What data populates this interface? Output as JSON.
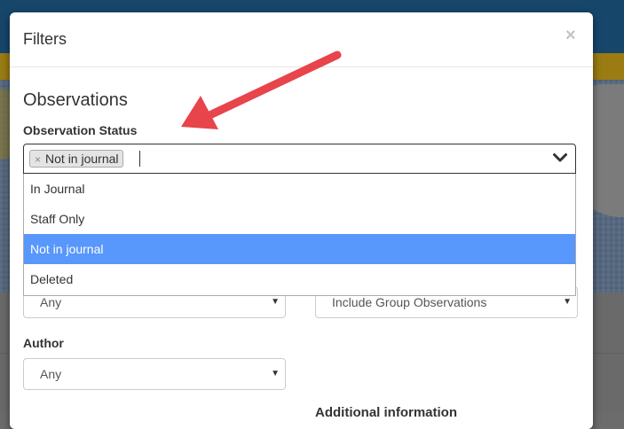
{
  "modal": {
    "title": "Filters",
    "close_symbol": "×",
    "section_title": "Observations"
  },
  "observation_status": {
    "label": "Observation Status",
    "selected_tag": "Not in journal",
    "tag_remove_symbol": "×",
    "options": [
      {
        "label": "In Journal",
        "selected": false
      },
      {
        "label": "Staff Only",
        "selected": false
      },
      {
        "label": "Not in journal",
        "selected": true
      },
      {
        "label": "Deleted",
        "selected": false
      }
    ]
  },
  "selects": {
    "left_value": "Any",
    "right_value": "Include Group Observations",
    "arrow_symbol": "▼"
  },
  "author": {
    "label": "Author",
    "value": "Any"
  },
  "partial_label": "Additional information",
  "colors": {
    "highlight": "#5897fb",
    "annotation_arrow": "#e8444b",
    "topbar": "#17466b"
  }
}
